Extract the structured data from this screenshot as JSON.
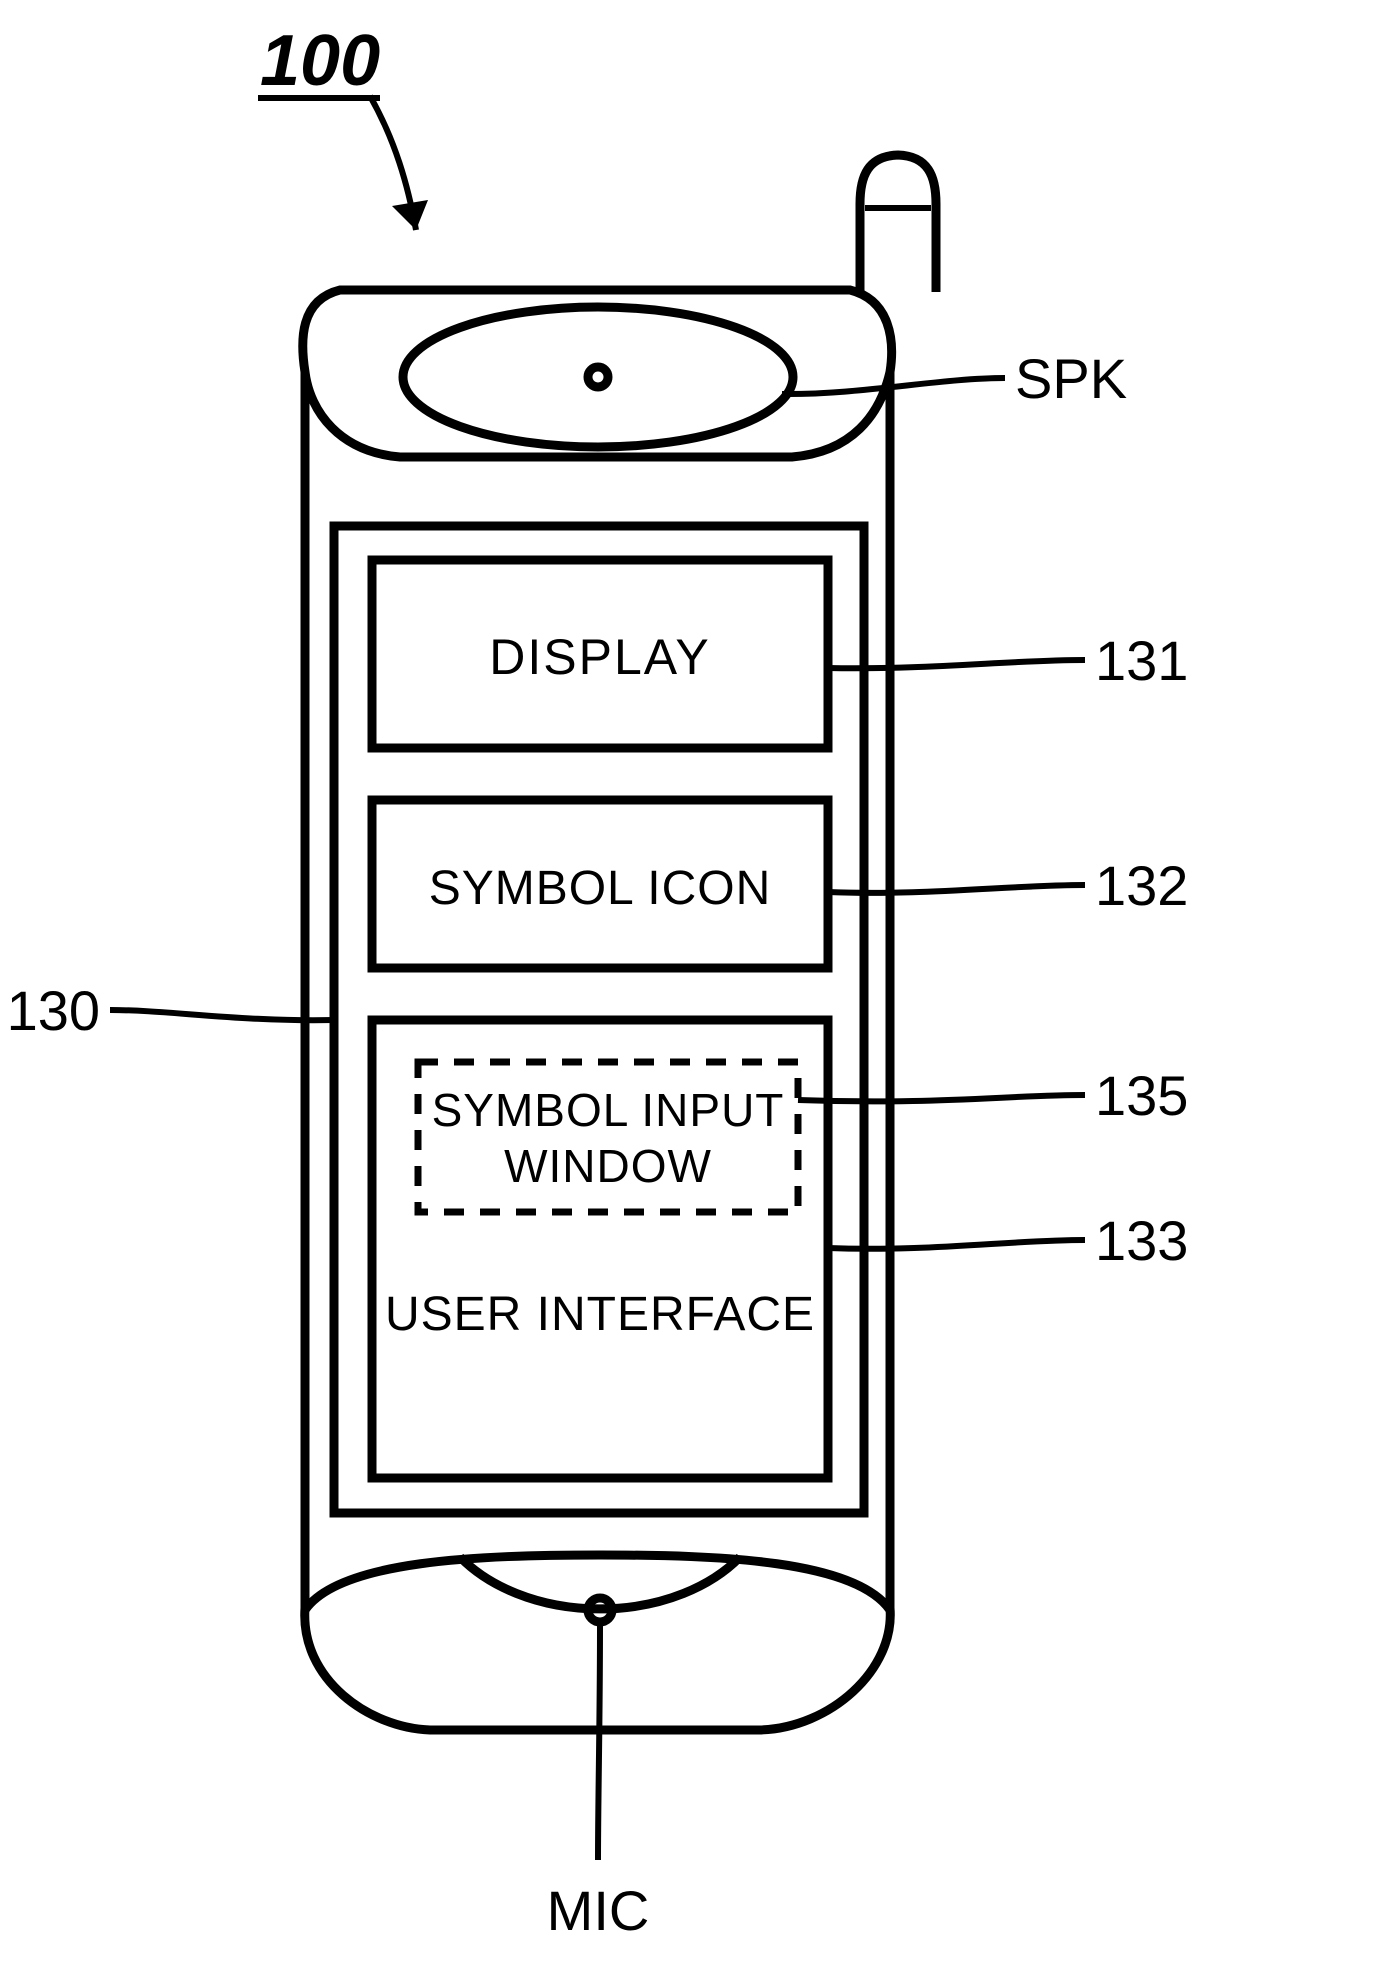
{
  "figure_ref": "100",
  "labels": {
    "spk": "SPK",
    "mic": "MIC",
    "display": "DISPLAY",
    "symbol_icon": "SYMBOL ICON",
    "symbol_input_window_l1": "SYMBOL INPUT",
    "symbol_input_window_l2": "WINDOW",
    "user_interface": "USER INTERFACE",
    "ref130": "130",
    "ref131": "131",
    "ref132": "132",
    "ref133": "133",
    "ref135": "135"
  }
}
